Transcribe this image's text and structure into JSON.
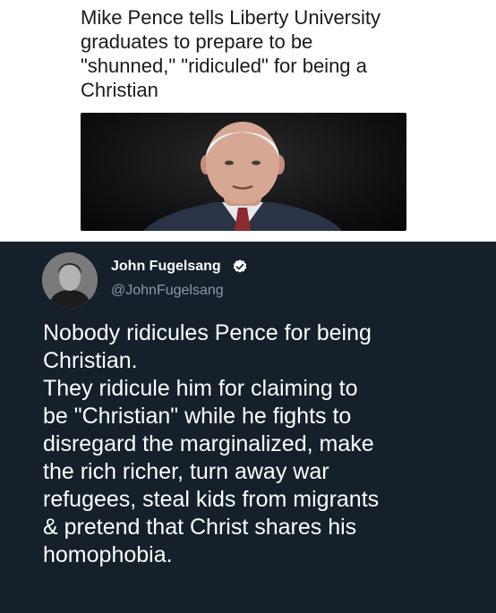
{
  "article": {
    "headline": "Mike Pence tells Liberty University\ngraduates to prepare to be\n\"shunned,\" \"ridiculed\" for being a\nChristian"
  },
  "tweet": {
    "display_name": "John Fugelsang",
    "handle": "@JohnFugelsang",
    "text": "Nobody ridicules Pence for being\nChristian.\nThey ridicule him for claiming to\nbe \"Christian\" while he fights to\ndisregard the marginalized, make\nthe rich richer, turn away war\nrefugees, steal kids from migrants\n& pretend that Christ shares his\nhomophobia.",
    "verified_color": "#ffffff",
    "background_color": "#15202b"
  }
}
